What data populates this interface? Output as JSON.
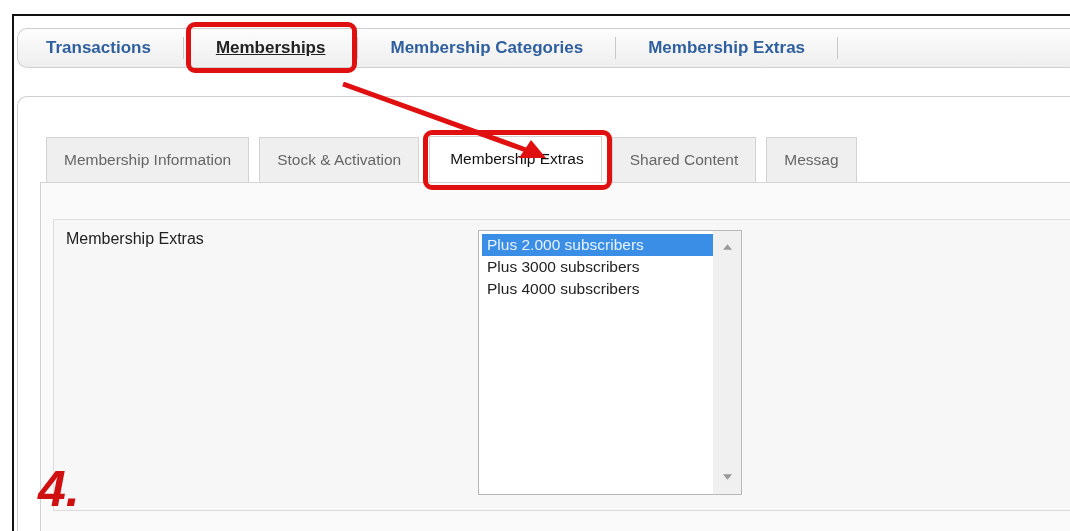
{
  "nav": [
    {
      "label": "Transactions",
      "selected": false,
      "highlighted": false
    },
    {
      "label": "Memberships",
      "selected": true,
      "highlighted": true
    },
    {
      "label": "Membership Categories",
      "selected": false,
      "highlighted": false
    },
    {
      "label": "Membership Extras",
      "selected": false,
      "highlighted": false
    }
  ],
  "tabs": [
    {
      "label": "Membership Information",
      "selected": false,
      "highlighted": false
    },
    {
      "label": "Stock & Activation",
      "selected": false,
      "highlighted": false
    },
    {
      "label": "Membership Extras",
      "selected": true,
      "highlighted": true
    },
    {
      "label": "Shared Content",
      "selected": false,
      "highlighted": false
    },
    {
      "label": "Messag",
      "selected": false,
      "highlighted": false
    }
  ],
  "form": {
    "label": "Membership Extras",
    "options": [
      {
        "label": "Plus 2.000 subscribers",
        "selected": true
      },
      {
        "label": "Plus 3000 subscribers",
        "selected": false
      },
      {
        "label": "Plus 4000 subscribers",
        "selected": false
      }
    ]
  },
  "step_label": "4."
}
